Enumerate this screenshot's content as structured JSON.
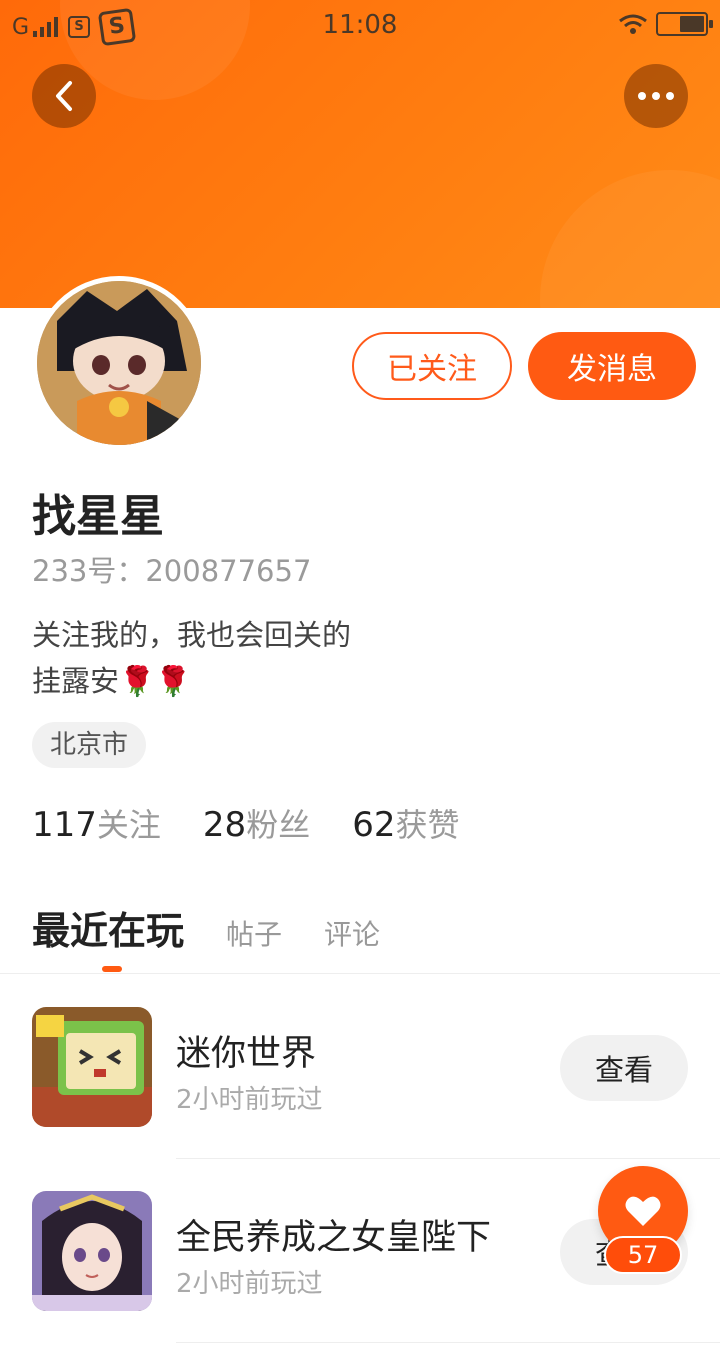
{
  "status_bar": {
    "network": "G",
    "sim_icon_text": "S",
    "app_icon_text": "S",
    "time": "11:08"
  },
  "header": {
    "back_icon": "chevron-left-icon",
    "more_icon": "more-dots-icon",
    "colors": {
      "gradient_start": "#ff6a0a",
      "gradient_end": "#ff8c18"
    }
  },
  "profile": {
    "follow_label": "已关注",
    "message_label": "发消息",
    "name": "找星星",
    "id_text": "233号：200877657",
    "bio_line1": "关注我的，我也会回关的",
    "bio_line2": "挂露安",
    "bio_emoji": "🌹🌹",
    "location": "北京市"
  },
  "stats": [
    {
      "num": "117",
      "label": "关注"
    },
    {
      "num": "28",
      "label": "粉丝"
    },
    {
      "num": "62",
      "label": "获赞"
    }
  ],
  "tabs": [
    {
      "label": "最近在玩",
      "active": true
    },
    {
      "label": "帖子",
      "active": false
    },
    {
      "label": "评论",
      "active": false
    }
  ],
  "games": [
    {
      "title": "迷你世界",
      "time": "2小时前玩过",
      "button": "查看"
    },
    {
      "title": "全民养成之女皇陛下",
      "time": "2小时前玩过",
      "button": "查看"
    }
  ],
  "fab": {
    "icon": "heart-icon",
    "count": "57"
  },
  "accent_color": "#ff5a12"
}
